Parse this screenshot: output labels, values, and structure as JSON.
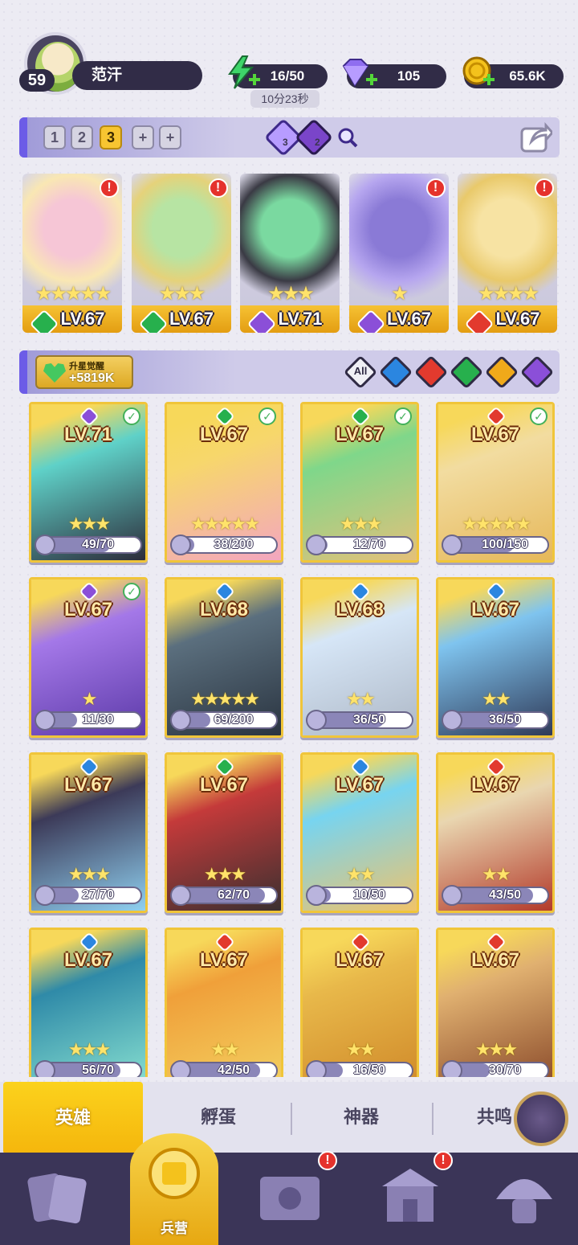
{
  "player": {
    "level": "59",
    "name": "范汗"
  },
  "resources": {
    "energy": "16/50",
    "energy_timer": "10分23秒",
    "gems": "105",
    "gold": "65.6K"
  },
  "team_tabs": [
    "1",
    "2",
    "3",
    "+",
    "+"
  ],
  "team_active_index": 2,
  "filter_counts": {
    "purple": "3",
    "dark": "2"
  },
  "team": [
    {
      "level": "LV.67",
      "stars": "★★★★★",
      "element": "green",
      "alert": "!"
    },
    {
      "level": "LV.67",
      "stars": "★★★",
      "element": "green",
      "alert": "!"
    },
    {
      "level": "LV.71",
      "stars": "★★★",
      "element": "purple",
      "alert": ""
    },
    {
      "level": "LV.67",
      "stars": "★",
      "element": "purple",
      "alert": "!"
    },
    {
      "level": "LV.67",
      "stars": "★★★★",
      "element": "red",
      "alert": "!"
    }
  ],
  "awaken": {
    "label": "升星觉醒",
    "value": "+5819K"
  },
  "element_filter_all": "All",
  "heroes": [
    {
      "level": "LV.71",
      "stars": "★★★",
      "shards": "49/70",
      "progress": 0.7,
      "element": "purple",
      "check": true
    },
    {
      "level": "LV.67",
      "stars": "★★★★★",
      "shards": "38/200",
      "progress": 0.19,
      "element": "green",
      "check": true
    },
    {
      "level": "LV.67",
      "stars": "★★★",
      "shards": "12/70",
      "progress": 0.17,
      "element": "green",
      "check": true
    },
    {
      "level": "LV.67",
      "stars": "★★★★★",
      "shards": "100/150",
      "progress": 0.67,
      "element": "red",
      "check": true
    },
    {
      "level": "LV.67",
      "stars": "★",
      "shards": "11/30",
      "progress": 0.37,
      "element": "purple",
      "check": true
    },
    {
      "level": "LV.68",
      "stars": "★★★★★",
      "shards": "69/200",
      "progress": 0.35,
      "element": "blue",
      "check": false
    },
    {
      "level": "LV.68",
      "stars": "★★",
      "shards": "36/50",
      "progress": 0.72,
      "element": "blue",
      "check": false
    },
    {
      "level": "LV.67",
      "stars": "★★",
      "shards": "36/50",
      "progress": 0.72,
      "element": "blue",
      "check": false
    },
    {
      "level": "LV.67",
      "stars": "★★★",
      "shards": "27/70",
      "progress": 0.39,
      "element": "blue",
      "check": false
    },
    {
      "level": "LV.67",
      "stars": "★★★",
      "shards": "62/70",
      "progress": 0.89,
      "element": "green",
      "check": false
    },
    {
      "level": "LV.67",
      "stars": "★★",
      "shards": "10/50",
      "progress": 0.2,
      "element": "blue",
      "check": false
    },
    {
      "level": "LV.67",
      "stars": "★★",
      "shards": "43/50",
      "progress": 0.86,
      "element": "red",
      "check": false
    },
    {
      "level": "LV.67",
      "stars": "★★★",
      "shards": "56/70",
      "progress": 0.8,
      "element": "blue",
      "check": false
    },
    {
      "level": "LV.67",
      "stars": "★★",
      "shards": "42/50",
      "progress": 0.84,
      "element": "red",
      "check": false
    },
    {
      "level": "LV.67",
      "stars": "★★",
      "shards": "16/50",
      "progress": 0.32,
      "element": "red",
      "check": false
    },
    {
      "level": "LV.67",
      "stars": "★★★",
      "shards": "30/70",
      "progress": 0.43,
      "element": "red",
      "check": false
    }
  ],
  "subtabs": [
    "英雄",
    "孵蛋",
    "神器",
    "共鸣"
  ],
  "nav": {
    "active_label": "兵营"
  },
  "colors": {
    "accent": "#6c5ce7",
    "gold": "#f5b60c",
    "nav_bg": "#3b3558"
  }
}
